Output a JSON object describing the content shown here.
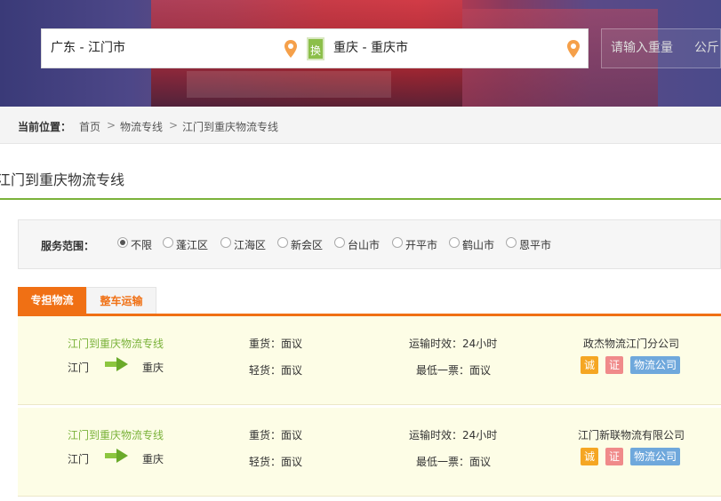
{
  "search": {
    "from_value": "广东 - 江门市",
    "swap_label": "换",
    "to_value": "重庆 - 重庆市",
    "weight_placeholder": "请输入重量",
    "weight_unit": "公斤"
  },
  "breadcrumb": {
    "label": "当前位置：",
    "items": [
      "首页",
      "物流专线",
      "江门到重庆物流专线"
    ],
    "separator": ">"
  },
  "page_title": "江门到重庆物流专线",
  "filter": {
    "label": "服务范围：",
    "options": [
      "不限",
      "蓬江区",
      "江海区",
      "新会区",
      "台山市",
      "开平市",
      "鹤山市",
      "恩平市"
    ],
    "selected": "不限"
  },
  "tabs": [
    {
      "label": "专担物流",
      "active": true
    },
    {
      "label": "整车运输",
      "active": false
    }
  ],
  "results": [
    {
      "route_name": "江门到重庆物流专线",
      "origin": "江门",
      "destination": "重庆",
      "heavy_goods": "重货：面议",
      "light_goods": "轻货：面议",
      "transit_time": "运输时效：24小时",
      "min_ticket": "最低一票：面议",
      "company": "政杰物流江门分公司",
      "badges": [
        "诚",
        "证",
        "物流公司"
      ]
    },
    {
      "route_name": "江门到重庆物流专线",
      "origin": "江门",
      "destination": "重庆",
      "heavy_goods": "重货：面议",
      "light_goods": "轻货：面议",
      "transit_time": "运输时效：24小时",
      "min_ticket": "最低一票：面议",
      "company": "江门新联物流有限公司",
      "badges": [
        "诚",
        "证",
        "物流公司"
      ]
    }
  ],
  "colors": {
    "accent_green": "#7ab23a",
    "accent_orange": "#f07014",
    "pin_orange": "#f5a04a",
    "badge_cheng": "#f5a623",
    "badge_zheng": "#f08a8a",
    "badge_company": "#6fa8dc",
    "row_background": "#fdfde6"
  }
}
